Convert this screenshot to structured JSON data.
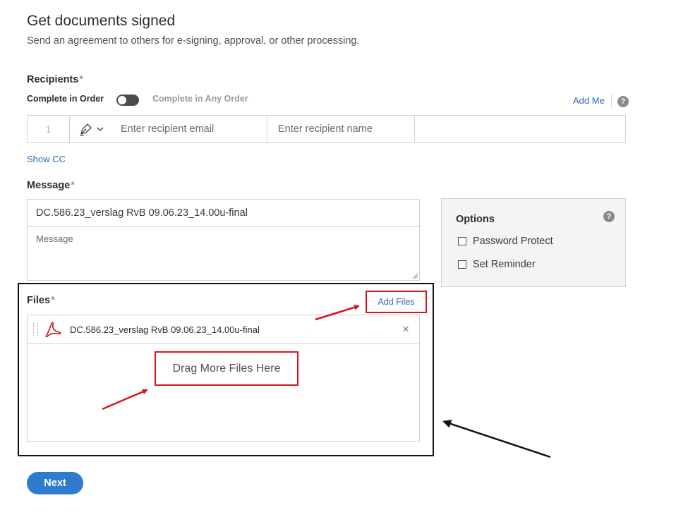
{
  "header": {
    "title": "Get documents signed",
    "subtitle": "Send an agreement to others for e-signing, approval, or other processing."
  },
  "recipients": {
    "label": "Recipients",
    "required_mark": "*",
    "order_in_order": "Complete in Order",
    "order_any": "Complete in Any Order",
    "add_me": "Add Me",
    "help": "?",
    "row": {
      "number": "1",
      "email_placeholder": "Enter recipient email",
      "name_placeholder": "Enter recipient name"
    },
    "show_cc": "Show CC"
  },
  "message": {
    "label": "Message",
    "required_mark": "*",
    "subject_value": "DC.586.23_verslag RvB 09.06.23_14.00u-final",
    "message_placeholder": "Message"
  },
  "options": {
    "title": "Options",
    "help": "?",
    "password_protect": "Password Protect",
    "set_reminder": "Set Reminder"
  },
  "files": {
    "label": "Files",
    "required_mark": "*",
    "add_files": "Add Files",
    "items": [
      {
        "name": "DC.586.23_verslag RvB 09.06.23_14.00u-final",
        "remove": "×"
      }
    ],
    "drag_text": "Drag More Files Here"
  },
  "footer": {
    "next": "Next"
  },
  "colors": {
    "link": "#2b6cb0",
    "primary_button": "#2f7bd0",
    "annotation_red": "#d9151b",
    "pdf_red": "#c5161d"
  },
  "icons": {
    "role": "pen-signer-icon",
    "file": "adobe-pdf-icon",
    "help": "help-question-icon"
  }
}
